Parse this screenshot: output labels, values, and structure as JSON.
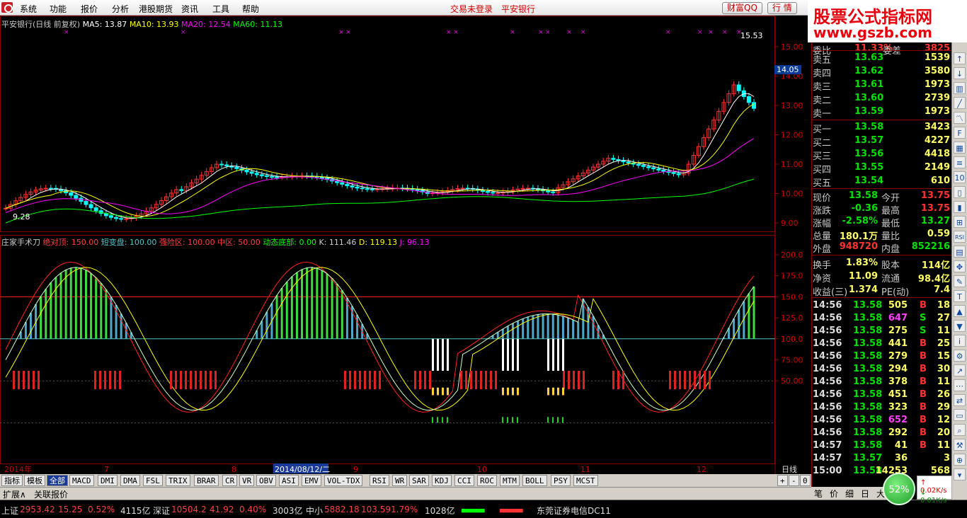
{
  "menu": [
    "系统",
    "功能",
    "报价",
    "分析",
    "港股期货",
    "资讯",
    "工具",
    "帮助"
  ],
  "topbar": {
    "login_status": "交易未登录",
    "bank": "平安银行",
    "btn_caifu": "财富QQ",
    "btn_market": "行 情"
  },
  "banner": {
    "line1": "股票公式指标网",
    "line2": "www.gszb.com"
  },
  "main_legend": {
    "title": "平安银行(日线 前复权)",
    "ma5": "MA5: 13.87",
    "ma10": "MA10: 13.93",
    "ma20": "MA20: 12.54",
    "ma60": "MA60: 11.13",
    "high_label": "15.53",
    "low_label": "9.28",
    "current_price": "14.05"
  },
  "price_axis": [
    "15.00",
    "14.00",
    "13.00",
    "12.00",
    "11.00",
    "10.00",
    "9.00"
  ],
  "indicator_legend": {
    "name": "庄家手术刀",
    "jdd": "绝对顶: 150.00",
    "dbp": "短变盘: 100.00",
    "qrq": "强险区: 100.00",
    "zq": "中区: 50.00",
    "dtdb": "动态底部: 0.00",
    "k": "K: 111.46",
    "d": "D: 119.13",
    "j": "J: 96.13"
  },
  "ind_axis": [
    "200.0",
    "175.0",
    "150.0",
    "125.0",
    "100.0",
    "75.00",
    "50.00"
  ],
  "x_axis": {
    "labels": [
      "2014年",
      "7",
      "8",
      "2014/08/12/二",
      "9",
      "10",
      "11",
      "12"
    ],
    "period": "日线"
  },
  "indicator_tabs": [
    "指标",
    "模板",
    "全部",
    "MACD",
    "DMI",
    "DMA",
    "FSL",
    "TRIX",
    "BRAR",
    "CR",
    "VR",
    "OBV",
    "ASI",
    "EMV",
    "VOL-TDX",
    "RSI",
    "WR",
    "SAR",
    "KDJ",
    "CCI",
    "ROC",
    "MTM",
    "BOLL",
    "PSY",
    "MCST"
  ],
  "ext_tabs": [
    "扩展∧",
    "关联报价"
  ],
  "quote": {
    "top_partial": {
      "label": "委比",
      "value": "11.33%",
      "label2": "委差",
      "value2": "3825"
    },
    "sells": [
      {
        "label": "卖五",
        "price": "13.63",
        "vol": "1539"
      },
      {
        "label": "卖四",
        "price": "13.62",
        "vol": "3580"
      },
      {
        "label": "卖三",
        "price": "13.61",
        "vol": "1973"
      },
      {
        "label": "卖二",
        "price": "13.60",
        "vol": "2739"
      },
      {
        "label": "卖一",
        "price": "13.59",
        "vol": "1973"
      }
    ],
    "buys": [
      {
        "label": "买一",
        "price": "13.58",
        "vol": "3423"
      },
      {
        "label": "买二",
        "price": "13.57",
        "vol": "4227"
      },
      {
        "label": "买三",
        "price": "13.56",
        "vol": "4418"
      },
      {
        "label": "买四",
        "price": "13.55",
        "vol": "2149"
      },
      {
        "label": "买五",
        "price": "13.54",
        "vol": "610"
      }
    ],
    "stats": [
      {
        "l1": "现价",
        "v1": "13.58",
        "l2": "今开",
        "v2": "13.75"
      },
      {
        "l1": "涨跌",
        "v1": "-0.36",
        "l2": "最高",
        "v2": "13.75"
      },
      {
        "l1": "涨幅",
        "v1": "-2.58%",
        "l2": "最低",
        "v2": "13.27"
      },
      {
        "l1": "总量",
        "v1": "180.1万",
        "l2": "量比",
        "v2": "0.59"
      },
      {
        "l1": "外盘",
        "v1": "948720",
        "l2": "内盘",
        "v2": "852216"
      }
    ],
    "stats2": [
      {
        "l1": "换手",
        "v1": "1.83%",
        "l2": "股本",
        "v2": "114亿"
      },
      {
        "l1": "净资",
        "v1": "11.09",
        "l2": "流通",
        "v2": "98.4亿"
      },
      {
        "l1": "收益(三)",
        "v1": "1.374",
        "l2": "PE(动)",
        "v2": "7.4"
      }
    ]
  },
  "ticks": [
    {
      "t": "14:56",
      "p": "13.58",
      "v": "505",
      "bs": "B",
      "n": "18"
    },
    {
      "t": "14:56",
      "p": "13.58",
      "v": "647",
      "bs": "S",
      "n": "27"
    },
    {
      "t": "14:56",
      "p": "13.58",
      "v": "275",
      "bs": "S",
      "n": "11"
    },
    {
      "t": "14:56",
      "p": "13.58",
      "v": "441",
      "bs": "B",
      "n": "25"
    },
    {
      "t": "14:56",
      "p": "13.58",
      "v": "279",
      "bs": "B",
      "n": "15"
    },
    {
      "t": "14:56",
      "p": "13.58",
      "v": "294",
      "bs": "B",
      "n": "30"
    },
    {
      "t": "14:56",
      "p": "13.58",
      "v": "378",
      "bs": "B",
      "n": "11"
    },
    {
      "t": "14:56",
      "p": "13.58",
      "v": "451",
      "bs": "B",
      "n": "26"
    },
    {
      "t": "14:56",
      "p": "13.58",
      "v": "323",
      "bs": "B",
      "n": "29"
    },
    {
      "t": "14:56",
      "p": "13.58",
      "v": "652",
      "bs": "B",
      "n": "12"
    },
    {
      "t": "14:56",
      "p": "13.58",
      "v": "292",
      "bs": "B",
      "n": "20"
    },
    {
      "t": "14:57",
      "p": "13.58",
      "v": "41",
      "bs": "B",
      "n": "11"
    },
    {
      "t": "14:57",
      "p": "13.57",
      "v": "36",
      "bs": "",
      "n": "3"
    },
    {
      "t": "15:00",
      "p": "13.58",
      "v": "14253",
      "bs": "",
      "n": "568"
    }
  ],
  "panel_tabs": [
    "笔",
    "价",
    "细",
    "日",
    "大"
  ],
  "status": {
    "sh_label": "上证",
    "sh_val": "2953.42",
    "sh_chg": "15.25",
    "sh_pct": "0.52%",
    "sh_amt": "4115亿",
    "sz_label": "深证",
    "sz_val": "10504.2",
    "sz_chg": "41.92",
    "sz_pct": "0.40%",
    "sz_amt": "3003亿",
    "zx_label": "中小",
    "zx_val": "5882.18",
    "zx_chg": "103.59",
    "zx_pct": "1.79%",
    "zx_amt": "1028亿",
    "broker": "东莞证券电信DC11"
  },
  "speed": {
    "percent": "52%",
    "up": "0.02K/s",
    "down": "0.01K/s"
  },
  "colors": {
    "up": "#ff3232",
    "down": "#00ffff",
    "ma5": "#ffffff",
    "ma10": "#ffff00",
    "ma20": "#ff00ff",
    "ma60": "#00ff00",
    "kline": "#ffffff"
  }
}
